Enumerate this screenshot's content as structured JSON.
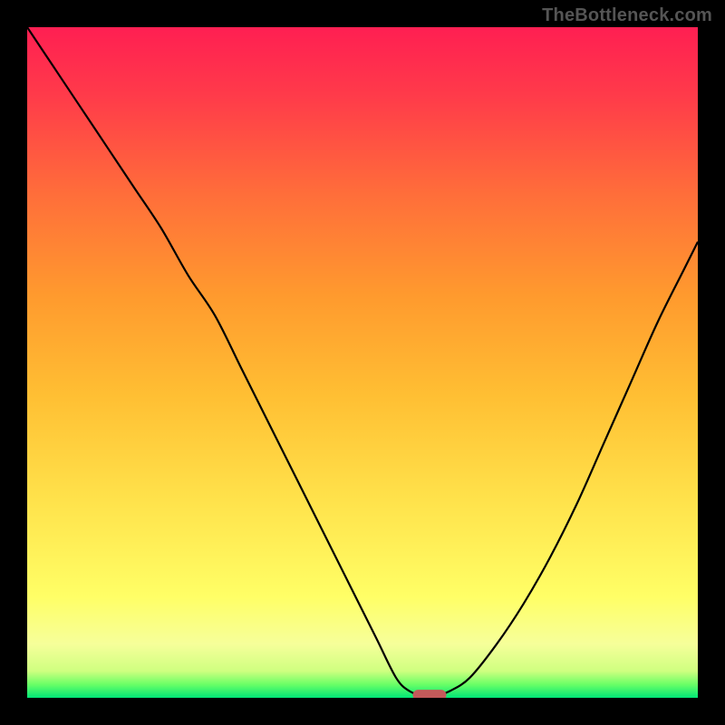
{
  "watermark": "TheBottleneck.com",
  "chart_data": {
    "type": "line",
    "title": "",
    "xlabel": "",
    "ylabel": "",
    "xlim": [
      0,
      100
    ],
    "ylim": [
      0,
      100
    ],
    "grid": false,
    "x": [
      0,
      4,
      8,
      12,
      16,
      20,
      24,
      28,
      32,
      36,
      40,
      44,
      48,
      52,
      55,
      57,
      59,
      61,
      63,
      66,
      70,
      74,
      78,
      82,
      86,
      90,
      94,
      98,
      100
    ],
    "y": [
      100,
      94,
      88,
      82,
      76,
      70,
      63,
      57,
      49,
      41,
      33,
      25,
      17,
      9,
      3,
      1,
      0.4,
      0.4,
      1,
      3,
      8,
      14,
      21,
      29,
      38,
      47,
      56,
      64,
      68
    ],
    "optimal_x": 60,
    "gradient_stops": [
      {
        "offset": 0.0,
        "color": "#00e676"
      },
      {
        "offset": 0.02,
        "color": "#6aff66"
      },
      {
        "offset": 0.04,
        "color": "#cfff80"
      },
      {
        "offset": 0.08,
        "color": "#f6ff9a"
      },
      {
        "offset": 0.15,
        "color": "#ffff66"
      },
      {
        "offset": 0.3,
        "color": "#ffe14a"
      },
      {
        "offset": 0.45,
        "color": "#ffbf33"
      },
      {
        "offset": 0.6,
        "color": "#ff9a2e"
      },
      {
        "offset": 0.75,
        "color": "#ff6e3a"
      },
      {
        "offset": 0.9,
        "color": "#ff3a4a"
      },
      {
        "offset": 1.0,
        "color": "#ff1f52"
      }
    ],
    "marker": {
      "x": 60,
      "y": 0.4,
      "color": "#c45a5a",
      "width": 5,
      "height": 1.6
    },
    "line_color": "#000000"
  }
}
